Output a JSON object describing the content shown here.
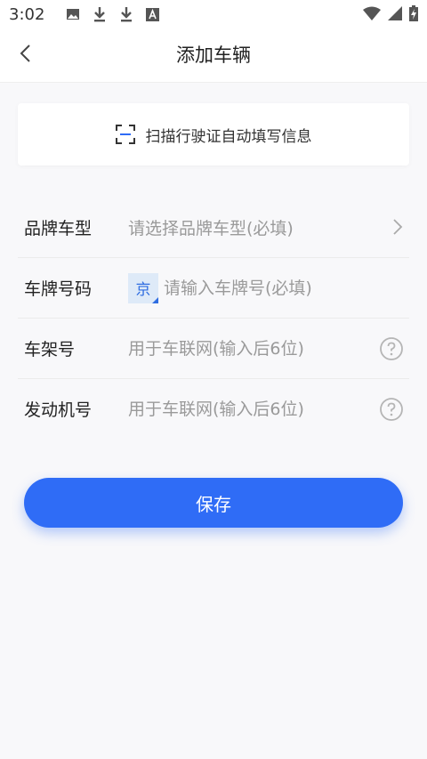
{
  "status_bar": {
    "time": "3:02",
    "left_icons": [
      "image-icon",
      "download-icon",
      "download-icon",
      "font-icon"
    ],
    "right_icons": [
      "wifi-icon",
      "signal-icon",
      "battery-charging-icon"
    ]
  },
  "nav": {
    "title": "添加车辆",
    "back_icon": "chevron-left-icon"
  },
  "scan": {
    "label": "扫描行驶证自动填写信息",
    "icon": "scan-frame-icon"
  },
  "form": {
    "brand": {
      "label": "品牌车型",
      "placeholder": "请选择品牌车型(必填)"
    },
    "plate": {
      "label": "车牌号码",
      "province": "京",
      "placeholder": "请输入车牌号(必填)"
    },
    "vin": {
      "label": "车架号",
      "placeholder": "用于车联网(输入后6位)"
    },
    "engine": {
      "label": "发动机号",
      "placeholder": "用于车联网(输入后6位)"
    }
  },
  "save_button": {
    "label": "保存"
  },
  "colors": {
    "accent": "#2f6cf6",
    "province_bg": "#deeaf8",
    "province_text": "#2f6de1",
    "page_bg": "#f8f8fa"
  }
}
